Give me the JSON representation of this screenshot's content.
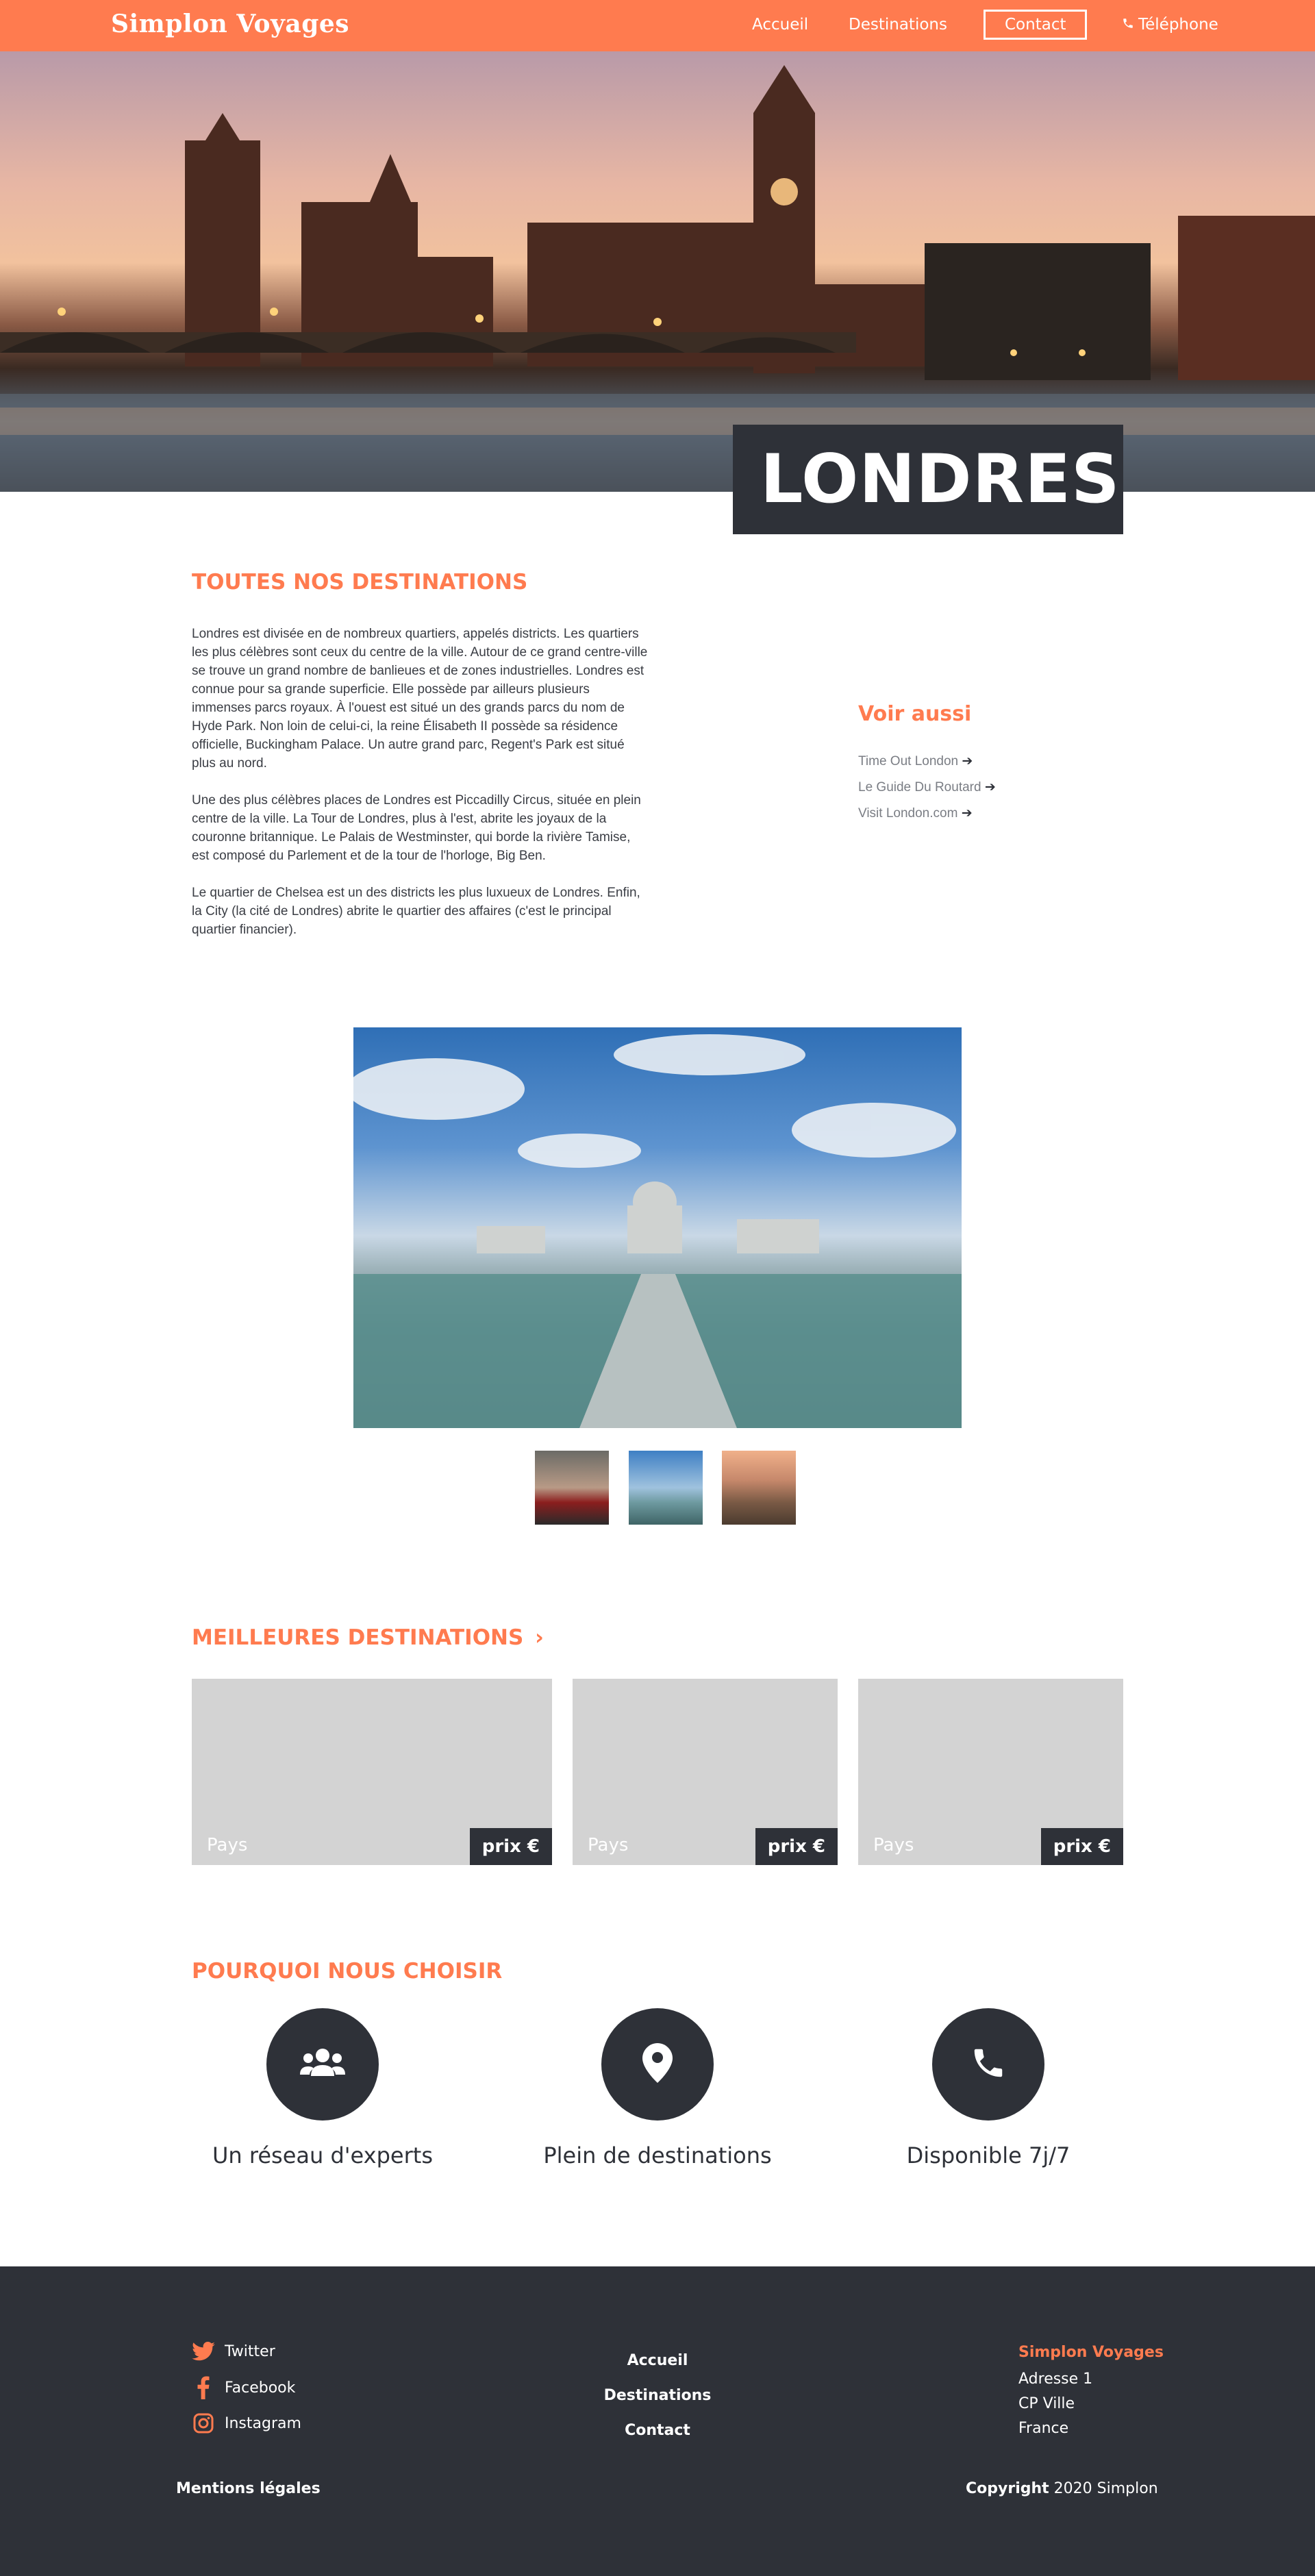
{
  "header": {
    "logo": "Simplon Voyages",
    "nav": [
      "Accueil",
      "Destinations",
      "Contact"
    ],
    "phone_label": "Téléphone"
  },
  "hero": {
    "city": "LONDRES"
  },
  "intro": {
    "heading": "TOUTES NOS DESTINATIONS",
    "paragraphs": [
      "Londres est divisée en de nombreux quartiers, appelés districts. Les quartiers les plus célèbres sont ceux du centre de la ville. Autour de ce grand centre-ville se trouve un grand nombre de banlieues et de zones industrielles. Londres est connue pour sa grande superficie. Elle possède par ailleurs plusieurs immenses parcs royaux. À l'ouest est situé un des grands parcs du nom de Hyde Park. Non loin de celui-ci, la reine Élisabeth II possède sa résidence officielle, Buckingham Palace. Un autre grand parc, Regent's Park est situé plus au nord.",
      "Une des plus célèbres places de Londres est Piccadilly Circus, située en plein centre de la ville. La Tour de Londres, plus à l'est, abrite les joyaux de la couronne britannique. Le Palais de Westminster, qui borde la rivière Tamise, est composé du Parlement et de la tour de l'horloge, Big Ben.",
      "Le quartier de Chelsea est un des districts les plus luxueux de Londres. Enfin, la City (la cité de Londres) abrite le quartier des affaires (c'est le principal quartier financier)."
    ]
  },
  "see_also": {
    "heading": "Voir aussi",
    "links": [
      "Time Out London",
      "Le Guide Du Routard",
      "Visit London.com"
    ]
  },
  "best": {
    "heading": "MEILLEURES DESTINATIONS",
    "cards": [
      {
        "country": "Pays",
        "price": "prix €"
      },
      {
        "country": "Pays",
        "price": "prix €"
      },
      {
        "country": "Pays",
        "price": "prix €"
      }
    ]
  },
  "why": {
    "heading": "POURQUOI NOUS CHOISIR",
    "items": [
      {
        "icon": "users-icon",
        "label": "Un réseau d'experts"
      },
      {
        "icon": "map-pin-icon",
        "label": "Plein de destinations"
      },
      {
        "icon": "phone-icon",
        "label": "Disponible 7j/7"
      }
    ]
  },
  "footer": {
    "social": [
      "Twitter",
      "Facebook",
      "Instagram"
    ],
    "nav": [
      "Accueil",
      "Destinations",
      "Contact"
    ],
    "company": "Simplon Voyages",
    "address": [
      "Adresse 1",
      "CP Ville",
      "France"
    ],
    "legal": "Mentions légales",
    "copyright_bold": "Copyright",
    "copyright_rest": " 2020 Simplon"
  },
  "colors": {
    "accent": "#ff7b4f",
    "dark": "#2e3138",
    "card": "#d3d3d3"
  }
}
